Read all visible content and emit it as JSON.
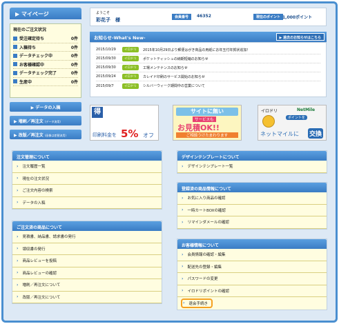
{
  "mypage": {
    "title": "マイページ"
  },
  "order_status": {
    "title": "現在のご注文状況",
    "items": [
      {
        "label": "受注確定待ち",
        "count": "0件"
      },
      {
        "label": "入稿待ち",
        "count": "0件"
      },
      {
        "label": "データチェック中",
        "count": "0件"
      },
      {
        "label": "お客様確認中",
        "count": "0件"
      },
      {
        "label": "データチェック完了",
        "count": "0件"
      },
      {
        "label": "生産中",
        "count": "0件"
      }
    ]
  },
  "side_buttons": {
    "data_upload": "データの入稿",
    "extra_order": "増刷／再注文",
    "extra_order_note": "(データ流用)",
    "revision_order": "改版／再注文",
    "revision_order_note": "(画像は差替流用)"
  },
  "welcome": {
    "greeting": "ようこそ",
    "user_name": "彩花子　様",
    "member_no_label": "会員番号",
    "member_no": "46352",
    "points_label": "現在のポイント",
    "points": "1,000ポイント"
  },
  "notices": {
    "title": "お知らせ-What's New-",
    "past_link": "過去のお知らせはこちら",
    "items": [
      {
        "date": "2015/10/29",
        "tag": "イロドリ",
        "text": "2015年10月29日より郵便はがき商品の用紙にお年玉付年賀状追加！"
      },
      {
        "date": "2015/09/30",
        "tag": "イロドリ",
        "text": "ポケットティッシュの納期短縮のお知らせ"
      },
      {
        "date": "2015/09/30",
        "tag": "イロドリ",
        "text": "工場メンテナンスのお知らせ"
      },
      {
        "date": "2015/09/24",
        "tag": "イロドリ",
        "text": "カレイド印刷のサービス開始のお知らせ"
      },
      {
        "date": "2015/09/7",
        "tag": "イロドリ",
        "text": "シルバーウィーク期間中の営業について"
      }
    ]
  },
  "banners": {
    "b1_icon": "得",
    "b1_line1": "セルフデータ",
    "b1_line2": "チェックで",
    "b1_line3": "印刷料金を",
    "b1_pct": "5%",
    "b1_off": "オフ",
    "b2_line1": "サイトに無い",
    "b2_line2": "サービスも",
    "b2_line3": "お見積OK!!",
    "b2_line4": "ご相談うけたまわります",
    "b3_brand1": "イロドリ",
    "b3_brand2": "NetMile",
    "b3_line1": "ポイントを",
    "b3_line2": "ネットマイルに",
    "b3_line3": "交換"
  },
  "panels": {
    "order_mgmt": {
      "title": "注文管理について",
      "items": [
        "注文履歴一覧",
        "現在の注文状況",
        "ご注文内容の検索",
        "データの入稿"
      ]
    },
    "order_products": {
      "title": "ご注文済の商品について",
      "items": [
        "見積書、納品書、請求書の発行",
        "領収書の発行",
        "商品レビューを投稿",
        "商品レビューの確認",
        "増刷／再注文について",
        "改版／再注文について"
      ]
    },
    "design_tpl": {
      "title": "デザインテンプレートについて",
      "items": [
        "デザインテンプレート一覧"
      ]
    },
    "registered": {
      "title": "登録済の商品情報について",
      "items": [
        "お気に入り商品の確認",
        "一時カートBOXの確認",
        "リマインダメールの確認"
      ]
    },
    "customer": {
      "title": "お客様情報について",
      "items": [
        "会員情報の確認・編集",
        "配送先の登録・編集",
        "パスワードの変更",
        "イロドリポイントの確認",
        "退会手続き"
      ]
    }
  },
  "colors": {
    "accent": "#3a7cc4",
    "highlight": "#f5a020",
    "tag": "#8cbf26"
  }
}
